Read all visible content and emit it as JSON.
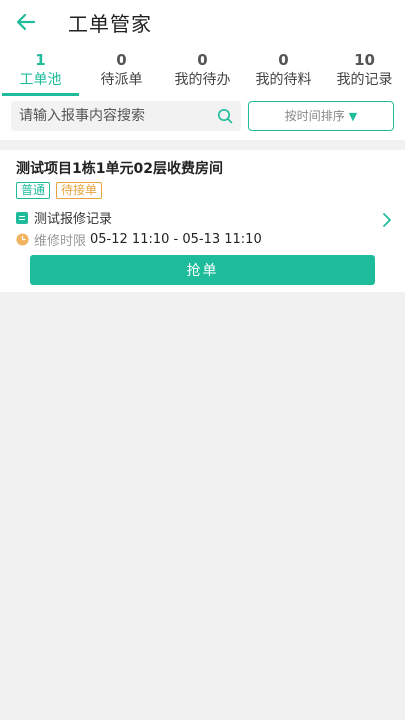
{
  "header": {
    "title": "工单管家",
    "back_icon": "arrow-left-icon"
  },
  "tabs": [
    {
      "count": "1",
      "label": "工单池",
      "active": true
    },
    {
      "count": "0",
      "label": "待派单"
    },
    {
      "count": "0",
      "label": "我的待办"
    },
    {
      "count": "0",
      "label": "我的待料"
    },
    {
      "count": "10",
      "label": "我的记录"
    }
  ],
  "search": {
    "placeholder": "请输入报事内容搜索",
    "icon": "search-icon"
  },
  "sort": {
    "label": "按时间排序",
    "icon": "caret-down-icon"
  },
  "order": {
    "title": "测试项目1栋1单元02层收费房间",
    "tags": [
      "普通",
      "待接单"
    ],
    "record_label": "测试报修记录",
    "time_label": "维修时限",
    "time_value": "05-12 11:10 - 05-13 11:10",
    "grab_label": "抢单"
  },
  "colors": {
    "accent": "#1fbc9c",
    "warning": "#e8a33e",
    "background": "#f1f1f1"
  }
}
